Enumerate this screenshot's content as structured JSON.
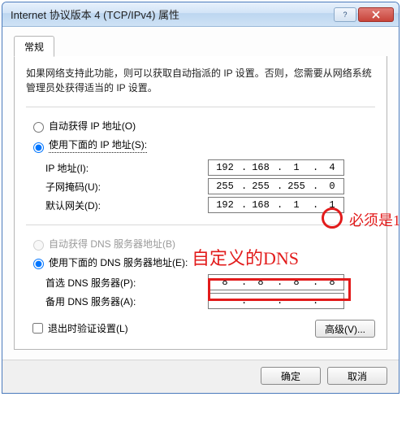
{
  "window": {
    "title": "Internet 协议版本 4 (TCP/IPv4) 属性"
  },
  "tab": {
    "general": "常规"
  },
  "description": "如果网络支持此功能，则可以获取自动指派的 IP 设置。否则，您需要从网络系统管理员处获得适当的 IP 设置。",
  "ipGroup": {
    "auto": "自动获得 IP 地址(O)",
    "manual": "使用下面的 IP 地址(S):",
    "ipLabel": "IP 地址(I):",
    "subnetLabel": "子网掩码(U):",
    "gatewayLabel": "默认网关(D):",
    "ip": [
      "192",
      "168",
      "1",
      "4"
    ],
    "subnet": [
      "255",
      "255",
      "255",
      "0"
    ],
    "gateway": [
      "192",
      "168",
      "1",
      "1"
    ]
  },
  "dnsGroup": {
    "auto": "自动获得 DNS 服务器地址(B)",
    "manual": "使用下面的 DNS 服务器地址(E):",
    "primaryLabel": "首选 DNS 服务器(P):",
    "altLabel": "备用 DNS 服务器(A):",
    "primary": [
      "8",
      "8",
      "8",
      "8"
    ],
    "alt": [
      "",
      "",
      "",
      ""
    ]
  },
  "validateCheckbox": "退出时验证设置(L)",
  "advancedBtn": "高级(V)...",
  "okBtn": "确定",
  "cancelBtn": "取消",
  "annotations": {
    "mustBe1": "必须是1",
    "customDNS": "自定义的DNS"
  }
}
